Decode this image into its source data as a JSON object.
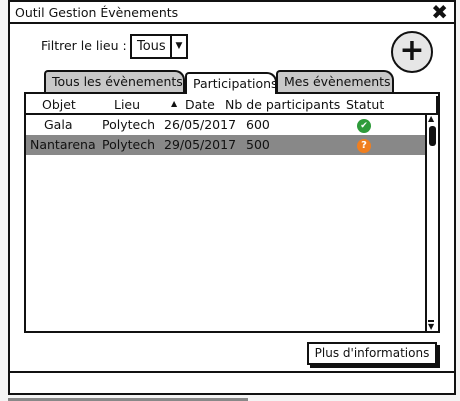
{
  "window": {
    "title": "Outil Gestion Évènements"
  },
  "filter": {
    "label": "Filtrer le lieu :",
    "value": "Tous"
  },
  "tabs": [
    {
      "label": "Tous les évènements"
    },
    {
      "label": "Participations"
    },
    {
      "label": "Mes évènements"
    }
  ],
  "table": {
    "columns": [
      "Objet",
      "Lieu",
      "Date",
      "Nb de participants",
      "Statut"
    ],
    "rows": [
      {
        "objet": "Gala",
        "lieu": "Polytech",
        "date": "26/05/2017",
        "nb": "600",
        "statut": "confirmed",
        "icon": "✔",
        "color": "#2e9b3a"
      },
      {
        "objet": "Nantarena",
        "lieu": "Polytech",
        "date": "29/05/2017",
        "nb": "500",
        "statut": "pending",
        "icon": "?",
        "color": "#f07f1f"
      }
    ]
  },
  "button": {
    "more_info": "Plus d'informations"
  }
}
